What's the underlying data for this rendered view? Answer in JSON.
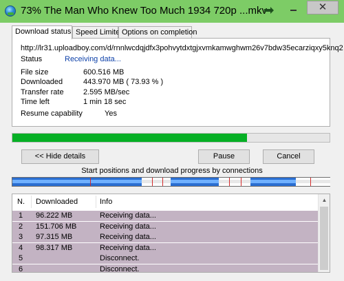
{
  "window": {
    "title": "73% The Man Who Knew Too Much 1934 720p ...mkv",
    "close_glyph": "✕",
    "accent_color": "#7dcc66"
  },
  "tabs": [
    {
      "label": "Download status",
      "active": true
    },
    {
      "label": "Speed Limiter",
      "active": false
    },
    {
      "label": "Options on completion",
      "active": false
    }
  ],
  "status_panel": {
    "url": "http://lr31.uploadboy.com/d/rnnlwcdqjdfx3pohvytdxtgjxvmkamwghwm26v7bdw35ecarziqxy5knq2",
    "status_label": "Status",
    "status_value": "Receiving data...",
    "file_size_label": "File size",
    "file_size_value": "600.516  MB",
    "downloaded_label": "Downloaded",
    "downloaded_value": "443.970  MB  ( 73.93 % )",
    "transfer_rate_label": "Transfer rate",
    "transfer_rate_value": "2.595  MB/sec",
    "time_left_label": "Time left",
    "time_left_value": "1 min 18 sec",
    "resume_label": "Resume capability",
    "resume_value": "Yes"
  },
  "progress": {
    "fraction": 0.7393,
    "color": "#06b025"
  },
  "buttons": {
    "hide_details": "<< Hide details",
    "pause": "Pause",
    "cancel": "Cancel"
  },
  "connections_caption": "Start positions and download progress by connections",
  "connections_table": {
    "columns": [
      "N.",
      "Downloaded",
      "Info"
    ],
    "rows": [
      {
        "n": "1",
        "downloaded": "96.222  MB",
        "info": "Receiving data..."
      },
      {
        "n": "2",
        "downloaded": "151.706  MB",
        "info": "Receiving data..."
      },
      {
        "n": "3",
        "downloaded": "97.315  MB",
        "info": "Receiving data..."
      },
      {
        "n": "4",
        "downloaded": "98.317  MB",
        "info": "Receiving data..."
      },
      {
        "n": "5",
        "downloaded": "",
        "info": "Disconnect."
      },
      {
        "n": "6",
        "downloaded": "",
        "info": "Disconnect."
      }
    ]
  }
}
